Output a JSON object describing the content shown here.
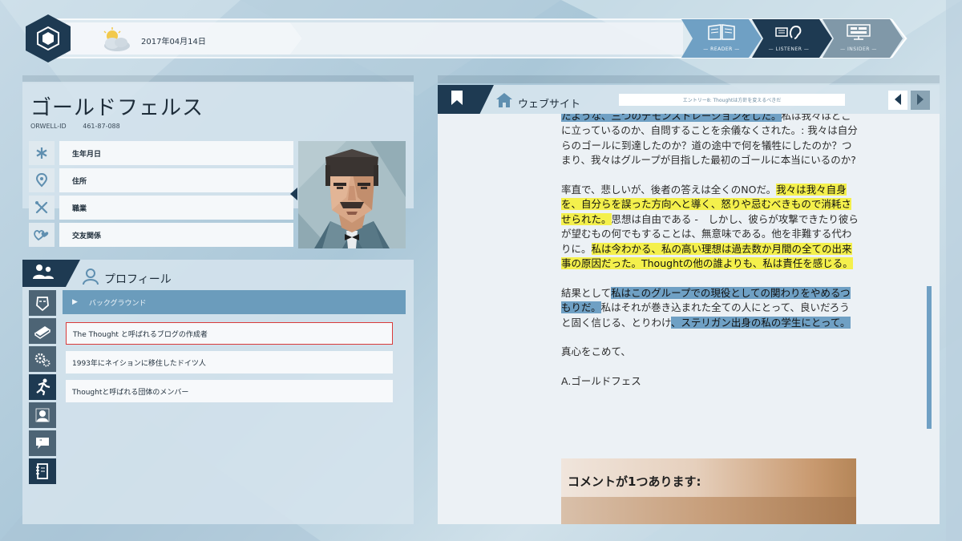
{
  "top": {
    "date": "2017年04月14日",
    "weather_icon": "partly-cloudy-icon",
    "modes": [
      {
        "label": "READER",
        "icon": "book-icon",
        "active": true
      },
      {
        "label": "LISTENER",
        "icon": "ear-icon",
        "active": false
      },
      {
        "label": "INSIDER",
        "icon": "monitor-icon",
        "active": false
      }
    ]
  },
  "person": {
    "name": "ゴールドフェルス",
    "id_label": "ORWELL-ID",
    "id_value": "461-87-088",
    "fields": [
      {
        "label": "生年月日",
        "icon": "asterisk-icon"
      },
      {
        "label": "住所",
        "icon": "location-pin-icon"
      },
      {
        "label": "職業",
        "icon": "tools-icon"
      },
      {
        "label": "交友関係",
        "icon": "hearts-icon"
      }
    ]
  },
  "profile": {
    "title": "プロフィール",
    "section": "バックグラウンド",
    "entries": [
      "The Thought と呼ばれるブログの作成者",
      "1993年にネイションに移住したドイツ人",
      "Thoughtと呼ばれる団体のメンバー"
    ],
    "side_icons": [
      "face-icon",
      "book-icon",
      "gears-icon",
      "running-icon",
      "silhouette-icon",
      "speech-bubble-icon",
      "notebook-icon"
    ]
  },
  "website": {
    "label": "ウェブサイト",
    "entry_title": "エントリー8: Thoughtは方針を変えるべきだ",
    "article": {
      "p1_hl": "たような、三つのデモンストレーションをした。",
      "p1_rest": "私は我々はどこに立っているのか、自問することを余儀なくされた。: 我々は自分らのゴールに到達したのか？道の途中で何を犠牲にしたのか？つまり、我々はグループが目指した最初のゴールに本当にいるのか?",
      "p2_a": "率直で、悲しいが、後者の答えは全くのNOだ。",
      "p2_hl1": "我々は我々自身を、自分らを誤った方向へと導く、怒りや忌むべきもので消耗させられた。",
      "p2_b": "思想は自由である -　しかし、彼らが攻撃できたり彼らが望むもの何でもすることは、無意味である。他を非難する代わりに。",
      "p2_hl2": "私は今わかる、私の高い理想は過去数か月間の全ての出来事の原因だった。Thoughtの他の誰よりも、私は責任を感じる。",
      "p3_a": "結果として",
      "p3_hl1": "私はこのグループでの現役としての関わりをやめるつもりだ。",
      "p3_b": "私はそれが巻き込まれた全ての人にとって、良いだろうと固く信じる、とりわけ",
      "p3_hl2": "、ステリガン出身の私の学生にとって。",
      "p4": "真心をこめて、",
      "p5": "A.ゴールドフェス"
    },
    "comments_title": "コメントが1つあります:"
  },
  "colors": {
    "navy": "#1e3a52",
    "highlight_blue": "#6fa0c4",
    "highlight_yellow": "#f4f04c",
    "selection_red": "#d93a3a"
  }
}
